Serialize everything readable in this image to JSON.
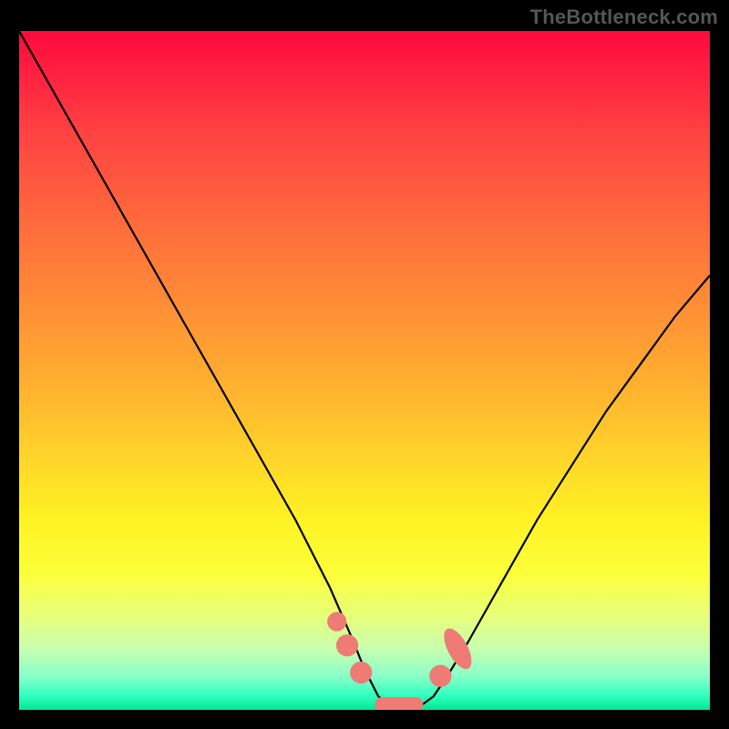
{
  "watermark": "TheBottleneck.com",
  "chart_data": {
    "type": "line",
    "title": "",
    "xlabel": "",
    "ylabel": "",
    "xlim": [
      0,
      100
    ],
    "ylim": [
      0,
      100
    ],
    "series": [
      {
        "name": "bottleneck-curve",
        "x": [
          0,
          5,
          10,
          15,
          20,
          25,
          30,
          35,
          40,
          45,
          48,
          50,
          52,
          54,
          56,
          58,
          60,
          62,
          65,
          70,
          75,
          80,
          85,
          90,
          95,
          100
        ],
        "values": [
          100,
          91,
          82,
          73,
          64,
          55,
          46,
          37,
          28,
          18,
          11,
          6,
          2,
          0.5,
          0,
          0.5,
          2,
          5,
          10,
          19,
          28,
          36,
          44,
          51,
          58,
          64
        ]
      }
    ],
    "markers": [
      {
        "name": "left-cluster-1",
        "x": 46.0,
        "y": 13.0,
        "size": 1.4
      },
      {
        "name": "left-cluster-2",
        "x": 47.5,
        "y": 9.5,
        "size": 1.6
      },
      {
        "name": "left-cluster-3",
        "x": 49.5,
        "y": 5.5,
        "size": 1.6
      },
      {
        "name": "bottom-bar",
        "x": 55.0,
        "y": 0.8,
        "size": 0,
        "bar": {
          "x0": 51.5,
          "x1": 58.5,
          "y": 0.8,
          "thickness": 2.2
        }
      },
      {
        "name": "right-cluster-1",
        "x": 61.0,
        "y": 5.0,
        "size": 1.6
      },
      {
        "name": "right-cluster-2",
        "x": 63.5,
        "y": 9.0,
        "size": 2.6,
        "elong": true
      }
    ],
    "marker_color": "#ee7b74",
    "curve_color": "#000000"
  }
}
